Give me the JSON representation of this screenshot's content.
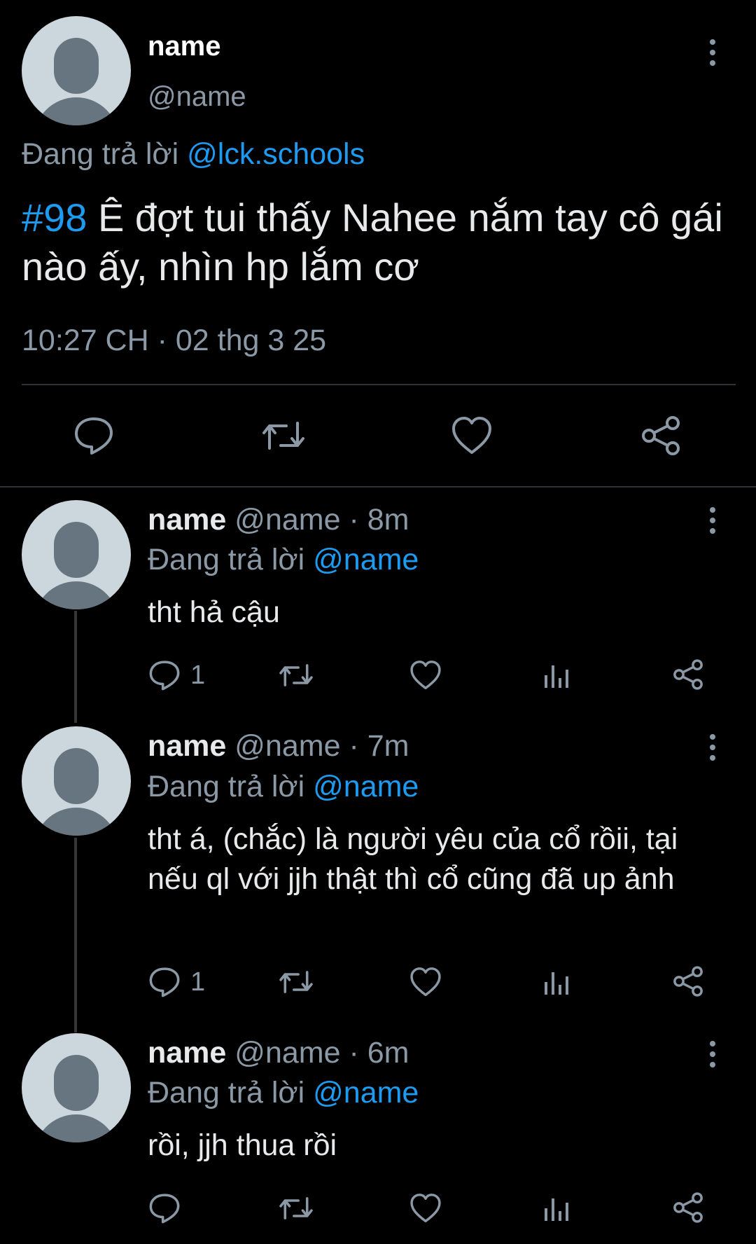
{
  "main_tweet": {
    "name": "name",
    "handle": "@name",
    "replying_prefix": "Đang trả lời ",
    "replying_to": "@lck.schools",
    "hashtag": "#98",
    "text": " Ê đợt tui thấy Nahee nắm tay cô gái nào ấy, nhìn hp lắm cơ",
    "timestamp": "10:27 CH · 02 thg 3 25"
  },
  "replies": [
    {
      "name": "name",
      "handle": "@name · 8m",
      "replying_prefix": "Đang trả lời ",
      "replying_to": "@name",
      "text": "tht hả cậu",
      "reply_count": "1"
    },
    {
      "name": "name",
      "handle": "@name · 7m",
      "replying_prefix": "Đang trả lời ",
      "replying_to": "@name",
      "text": "tht á, (chắc) là người yêu của cổ rồii, tại nếu ql với jjh thật thì cổ cũng đã up ảnh",
      "reply_count": "1"
    },
    {
      "name": "name",
      "handle": "@name · 6m",
      "replying_prefix": "Đang trả lời ",
      "replying_to": "@name",
      "text": "rồi, jjh thua rồi",
      "reply_count": ""
    }
  ],
  "icons": {
    "reply": "reply-icon",
    "retweet": "retweet-icon",
    "like": "heart-icon",
    "views": "views-icon",
    "share": "share-icon",
    "more": "more-icon"
  },
  "colors": {
    "background": "#000000",
    "accent": "#1d9bf0",
    "muted": "#8b98a5",
    "divider": "#2f3336"
  }
}
